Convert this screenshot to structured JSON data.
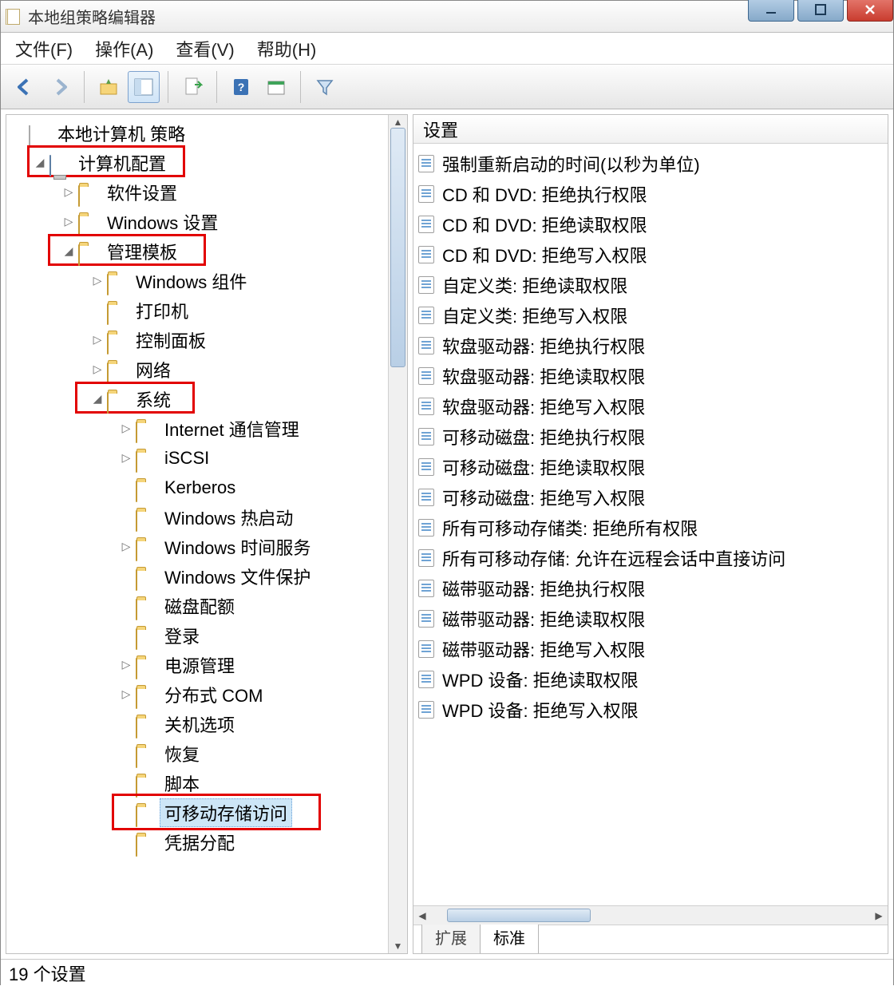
{
  "window": {
    "title": "本地组策略编辑器"
  },
  "menu": {
    "file": "文件(F)",
    "action": "操作(A)",
    "view": "查看(V)",
    "help": "帮助(H)"
  },
  "tree": {
    "root": "本地计算机 策略",
    "computer_config": "计算机配置",
    "software_settings": "软件设置",
    "windows_settings": "Windows 设置",
    "admin_templates": "管理模板",
    "windows_components": "Windows 组件",
    "printers": "打印机",
    "control_panel": "控制面板",
    "network": "网络",
    "system": "系统",
    "internet_comm": "Internet 通信管理",
    "iscsi": "iSCSI",
    "kerberos": "Kerberos",
    "windows_hotstart": "Windows 热启动",
    "windows_time": "Windows 时间服务",
    "windows_file_protection": "Windows 文件保护",
    "disk_quota": "磁盘配额",
    "logon": "登录",
    "power": "电源管理",
    "dcom": "分布式 COM",
    "shutdown_options": "关机选项",
    "recovery": "恢复",
    "scripts": "脚本",
    "removable_storage": "可移动存储访问",
    "cred_delegation": "凭据分配"
  },
  "list_header": "设置",
  "settings": [
    "强制重新启动的时间(以秒为单位)",
    "CD 和 DVD: 拒绝执行权限",
    "CD 和 DVD: 拒绝读取权限",
    "CD 和 DVD: 拒绝写入权限",
    "自定义类: 拒绝读取权限",
    "自定义类: 拒绝写入权限",
    "软盘驱动器: 拒绝执行权限",
    "软盘驱动器: 拒绝读取权限",
    "软盘驱动器: 拒绝写入权限",
    "可移动磁盘: 拒绝执行权限",
    "可移动磁盘: 拒绝读取权限",
    "可移动磁盘: 拒绝写入权限",
    "所有可移动存储类: 拒绝所有权限",
    "所有可移动存储: 允许在远程会话中直接访问",
    "磁带驱动器: 拒绝执行权限",
    "磁带驱动器: 拒绝读取权限",
    "磁带驱动器: 拒绝写入权限",
    "WPD 设备: 拒绝读取权限",
    "WPD 设备: 拒绝写入权限"
  ],
  "tabs": {
    "extended": "扩展",
    "standard": "标准"
  },
  "status": "19 个设置"
}
